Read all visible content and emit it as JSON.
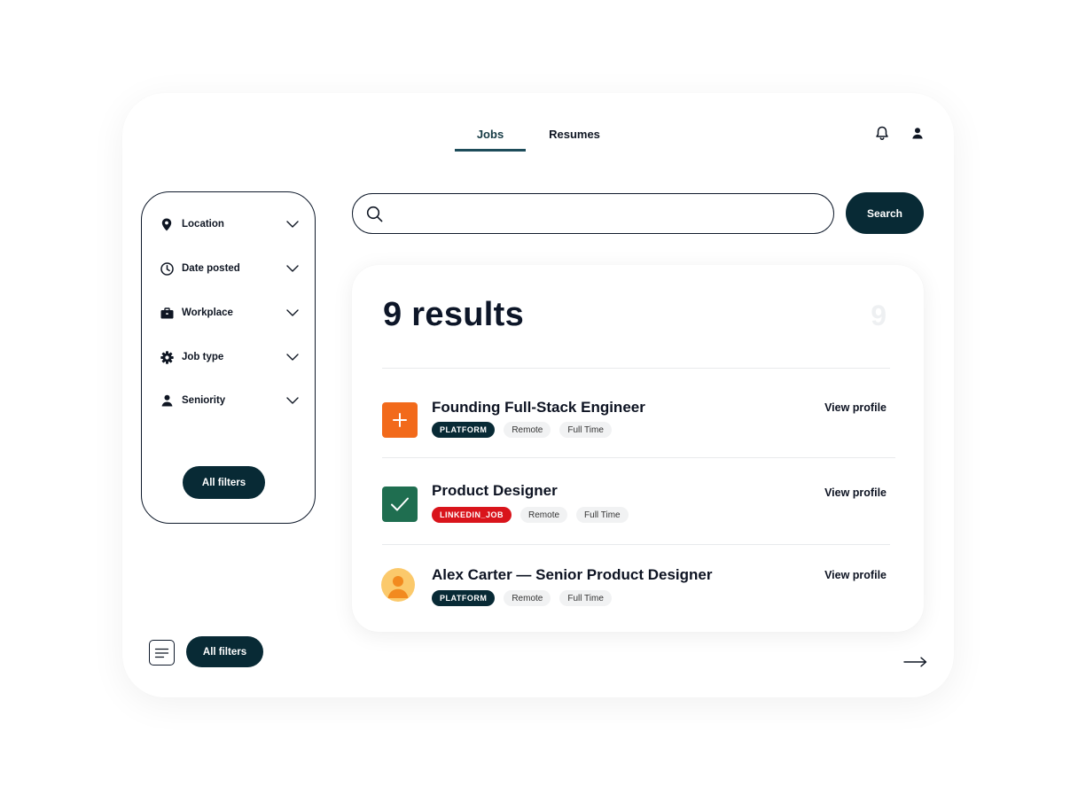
{
  "nav": {
    "tabs": [
      {
        "label": "Jobs",
        "active": true
      },
      {
        "label": "Resumes",
        "active": false
      }
    ],
    "icons": [
      "bell-icon",
      "user-icon"
    ]
  },
  "filters": {
    "items": [
      {
        "label": "Location",
        "icon": "map-pin-icon"
      },
      {
        "label": "Date posted",
        "icon": "clock-icon"
      },
      {
        "label": "Workplace",
        "icon": "briefcase-icon"
      },
      {
        "label": "Job type",
        "icon": "gear-icon"
      },
      {
        "label": "Seniority",
        "icon": "person-icon"
      }
    ],
    "all_filters_label": "All filters"
  },
  "search": {
    "value": "",
    "placeholder": "",
    "button_label": "Search"
  },
  "results": {
    "title": "9 results",
    "count_faint": "9",
    "items": [
      {
        "title": "Founding Full-Stack Engineer",
        "source": "PLATFORM",
        "tags": [
          "Remote",
          "Full Time"
        ],
        "action": "View profile",
        "logo_color": "#f26a1b"
      },
      {
        "title": "Product Designer",
        "source": "LINKEDIN_JOB",
        "tags": [
          "Remote",
          "Full Time"
        ],
        "action": "View profile",
        "logo_color": "#1f6e50"
      },
      {
        "title": "Alex Carter — Senior Product Designer",
        "source": "PLATFORM",
        "tags": [
          "Remote",
          "Full Time"
        ],
        "action": "View profile",
        "logo_color": "#fbc96b"
      }
    ]
  },
  "footer": {
    "all_filters_label": "All filters"
  },
  "colors": {
    "primary": "#082a35",
    "accent_tab": "#1d4c5a",
    "red_tag": "#d9141b"
  }
}
